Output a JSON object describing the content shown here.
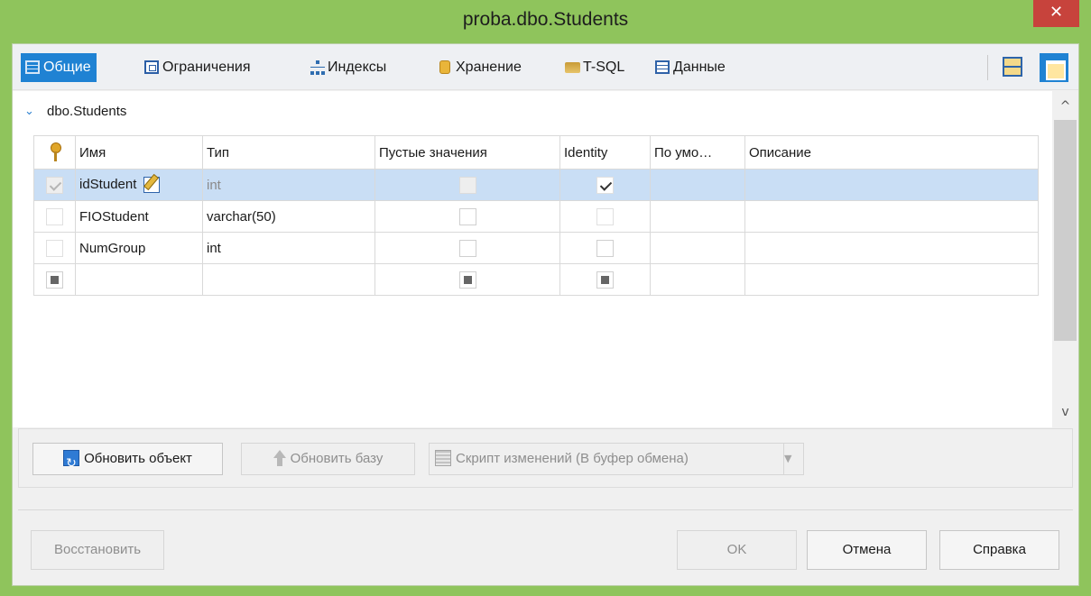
{
  "window": {
    "title": "proba.dbo.Students",
    "close_glyph": "✕"
  },
  "toolbar": {
    "tabs": [
      {
        "label": "Общие",
        "icon": "table-icon",
        "active": true
      },
      {
        "label": "Ограничения",
        "icon": "constraints-icon",
        "active": false
      },
      {
        "label": "Индексы",
        "icon": "index-icon",
        "active": false
      },
      {
        "label": "Хранение",
        "icon": "storage-icon",
        "active": false
      },
      {
        "label": "T-SQL",
        "icon": "tsql-icon",
        "active": false
      },
      {
        "label": "Данные",
        "icon": "data-grid-icon",
        "active": false
      }
    ],
    "accent_color": "#1f82d3"
  },
  "section": {
    "title": "dbo.Students",
    "expander_glyph": "⌄"
  },
  "grid": {
    "columns": [
      "",
      "Имя",
      "Тип",
      "Пустые значения",
      "Identity",
      "По умо…",
      "Описание"
    ],
    "rows": [
      {
        "pk": true,
        "name": "idStudent",
        "type": "int",
        "nullable": false,
        "identity": true,
        "default": "",
        "description": "",
        "selected": true
      },
      {
        "pk": false,
        "name": "FIOStudent",
        "type": "varchar(50)",
        "nullable": false,
        "identity": false,
        "default": "",
        "description": "",
        "selected": false
      },
      {
        "pk": false,
        "name": "NumGroup",
        "type": "int",
        "nullable": false,
        "identity": false,
        "default": "",
        "description": "",
        "selected": false
      },
      {
        "pk": null,
        "name": "",
        "type": "",
        "nullable": null,
        "identity": null,
        "default": "",
        "description": "",
        "selected": false
      }
    ],
    "selection_color": "#c9def5"
  },
  "actions": {
    "refresh_object": "Обновить объект",
    "update_db": "Обновить базу",
    "change_script": "Скрипт изменений (В буфер обмена)",
    "dropdown_glyph": "▼"
  },
  "footer": {
    "restore": "Восстановить",
    "ok": "OK",
    "cancel": "Отмена",
    "help": "Справка"
  },
  "scrollbar": {
    "up_glyph": "^",
    "down_glyph": "v"
  },
  "colors": {
    "window_frame": "#8fc45c",
    "close_button": "#c7433c"
  }
}
